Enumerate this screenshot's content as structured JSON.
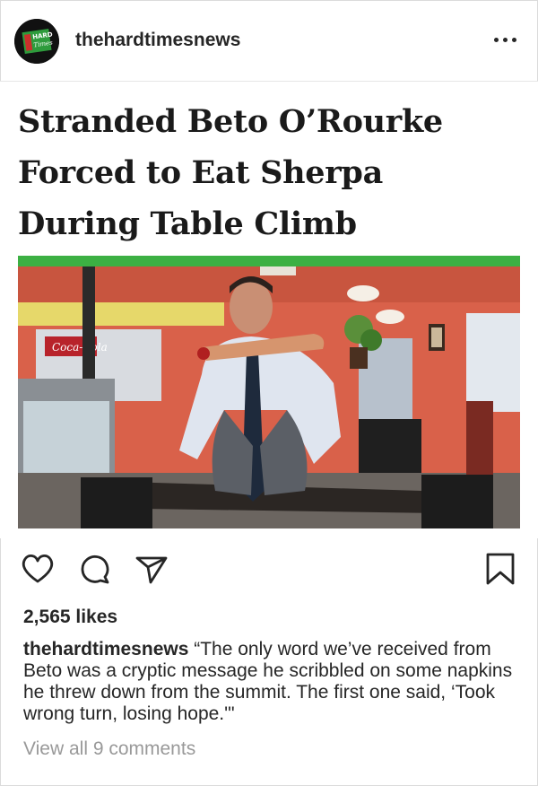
{
  "account": {
    "username": "thehardtimesnews",
    "avatar_text": "HARD Times"
  },
  "header": {
    "more_icon": "ellipsis-horizontal-icon"
  },
  "post": {
    "headline_lines": [
      "Stranded Beto O’Rourke",
      "Forced to Eat Sherpa",
      "During Table Climb"
    ],
    "accent_color": "#3cb043",
    "photo_sign_text": "Coca-Cola"
  },
  "actions": {
    "like_icon": "heart-icon",
    "comment_icon": "comment-icon",
    "share_icon": "send-icon",
    "save_icon": "bookmark-icon"
  },
  "likes_text": "2,565 likes",
  "caption": {
    "username": "thehardtimesnews",
    "text": "“The only word we’ve received from Beto was a cryptic message he scribbled on some napkins he threw down from the summit. The first one said, ‘Took wrong turn, losing hope.'\""
  },
  "comments_link": "View all 9 comments"
}
